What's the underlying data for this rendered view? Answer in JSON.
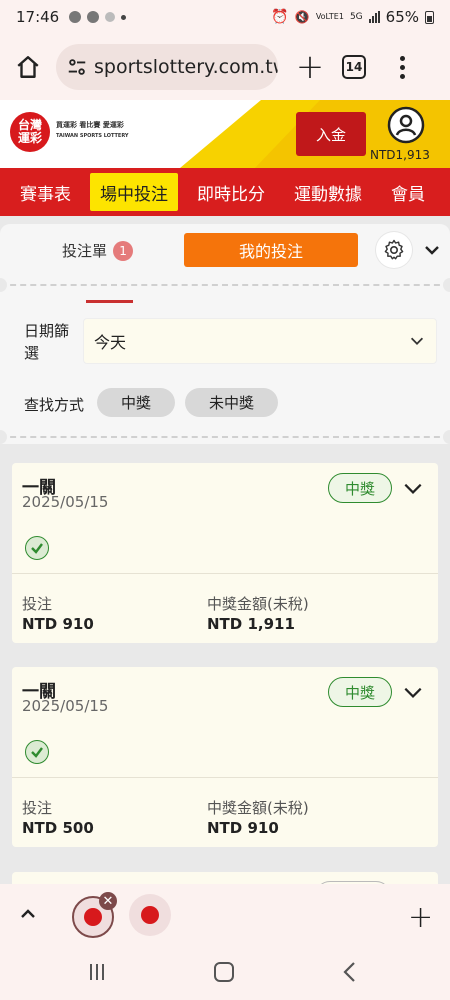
{
  "status_bar": {
    "time": "17:46",
    "network": "5G",
    "volte": "VoLTE1",
    "battery": "65%"
  },
  "browser": {
    "url": "sportslottery.com.tw",
    "tab_count": "14"
  },
  "site": {
    "logo_line1": "台灣",
    "logo_line2": "運彩",
    "logo_slogan": "買運彩 看比賽 愛運彩",
    "logo_sub": "TAIWAN SPORTS LOTTERY",
    "deposit_label": "入金",
    "balance": "NTD1,913"
  },
  "nav": {
    "items": [
      "賽事表",
      "場中投注",
      "即時比分",
      "運動數據",
      "會員"
    ],
    "active_index": 1
  },
  "panel": {
    "betslip_label": "投注單",
    "betslip_count": "1",
    "mybets_label": "我的投注",
    "date_filter_label": "日期篩選",
    "date_filter_value": "今天",
    "search_label": "查找方式",
    "filter_won": "中獎",
    "filter_not_won": "未中獎"
  },
  "bets": [
    {
      "title": "一關",
      "date": "2025/05/15",
      "status": "中獎",
      "stake_label": "投注",
      "stake": "NTD 910",
      "payout_label": "中獎金額(未稅)",
      "payout": "NTD 1,911"
    },
    {
      "title": "一關",
      "date": "2025/05/15",
      "status": "中獎",
      "stake_label": "投注",
      "stake": "NTD 500",
      "payout_label": "中獎金額(未稅)",
      "payout": "NTD 910"
    }
  ],
  "colors": {
    "brand_red": "#d81e1e",
    "nav_active": "#fde400",
    "mybets_orange": "#f5740b",
    "won_green": "#2f8b2f"
  }
}
